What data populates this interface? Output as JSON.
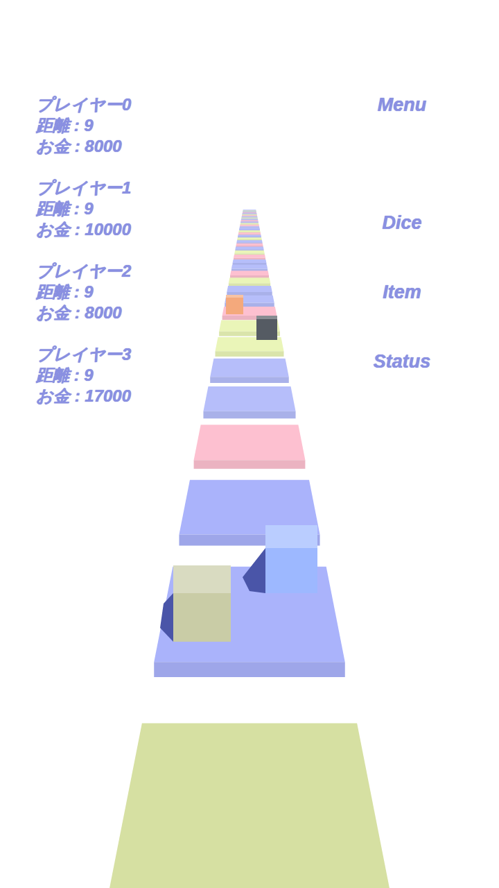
{
  "players": [
    {
      "name": "プレイヤー0",
      "distance": "距離 : 9",
      "money": "お金 : 8000"
    },
    {
      "name": "プレイヤー1",
      "distance": "距離 : 9",
      "money": "お金 : 10000"
    },
    {
      "name": "プレイヤー2",
      "distance": "距離 : 9",
      "money": "お金 : 8000"
    },
    {
      "name": "プレイヤー3",
      "distance": "距離 : 9",
      "money": "お金 : 17000"
    }
  ],
  "menu": [
    "Menu",
    "Dice",
    "Item",
    "Status"
  ],
  "pieces": [
    {
      "color": "#c9cca6"
    },
    {
      "color": "#9db8ff"
    },
    {
      "color": "#f4a97c"
    },
    {
      "color": "#555b63"
    }
  ],
  "tiles": [
    {
      "color": "#d6e0a2"
    },
    {
      "color": "#aab3fb"
    },
    {
      "color": "#aab3fb"
    },
    {
      "color": "#fdc0d0"
    },
    {
      "color": "#b6befa"
    },
    {
      "color": "#b6befa"
    },
    {
      "color": "#eaf5b8"
    },
    {
      "color": "#eaf5b8"
    },
    {
      "color": "#fdc0d0"
    },
    {
      "color": "#b6befa"
    },
    {
      "color": "#b6befa"
    },
    {
      "color": "#eaf5b8"
    },
    {
      "color": "#fdc0d0"
    },
    {
      "color": "#b6befa"
    },
    {
      "color": "#b6befa"
    },
    {
      "color": "#fdc0d0"
    },
    {
      "color": "#eaf5b8"
    },
    {
      "color": "#b6befa"
    },
    {
      "color": "#fdc0d0"
    },
    {
      "color": "#b6befa"
    },
    {
      "color": "#eaf5b8"
    },
    {
      "color": "#b6befa"
    },
    {
      "color": "#fdc0d0"
    },
    {
      "color": "#eaf5b8"
    },
    {
      "color": "#b6befa"
    },
    {
      "color": "#b6befa"
    },
    {
      "color": "#fdc0d0"
    },
    {
      "color": "#eaf5b8"
    },
    {
      "color": "#b6befa"
    },
    {
      "color": "#fdc0d0"
    },
    {
      "color": "#b6befa"
    },
    {
      "color": "#eaf5b8"
    },
    {
      "color": "#b6befa"
    },
    {
      "color": "#fdc0d0"
    },
    {
      "color": "#eaf5b8"
    },
    {
      "color": "#b6befa"
    },
    {
      "color": "#fdc0d0"
    },
    {
      "color": "#b6befa"
    },
    {
      "color": "#eaf5b8"
    },
    {
      "color": "#b6befa"
    }
  ]
}
